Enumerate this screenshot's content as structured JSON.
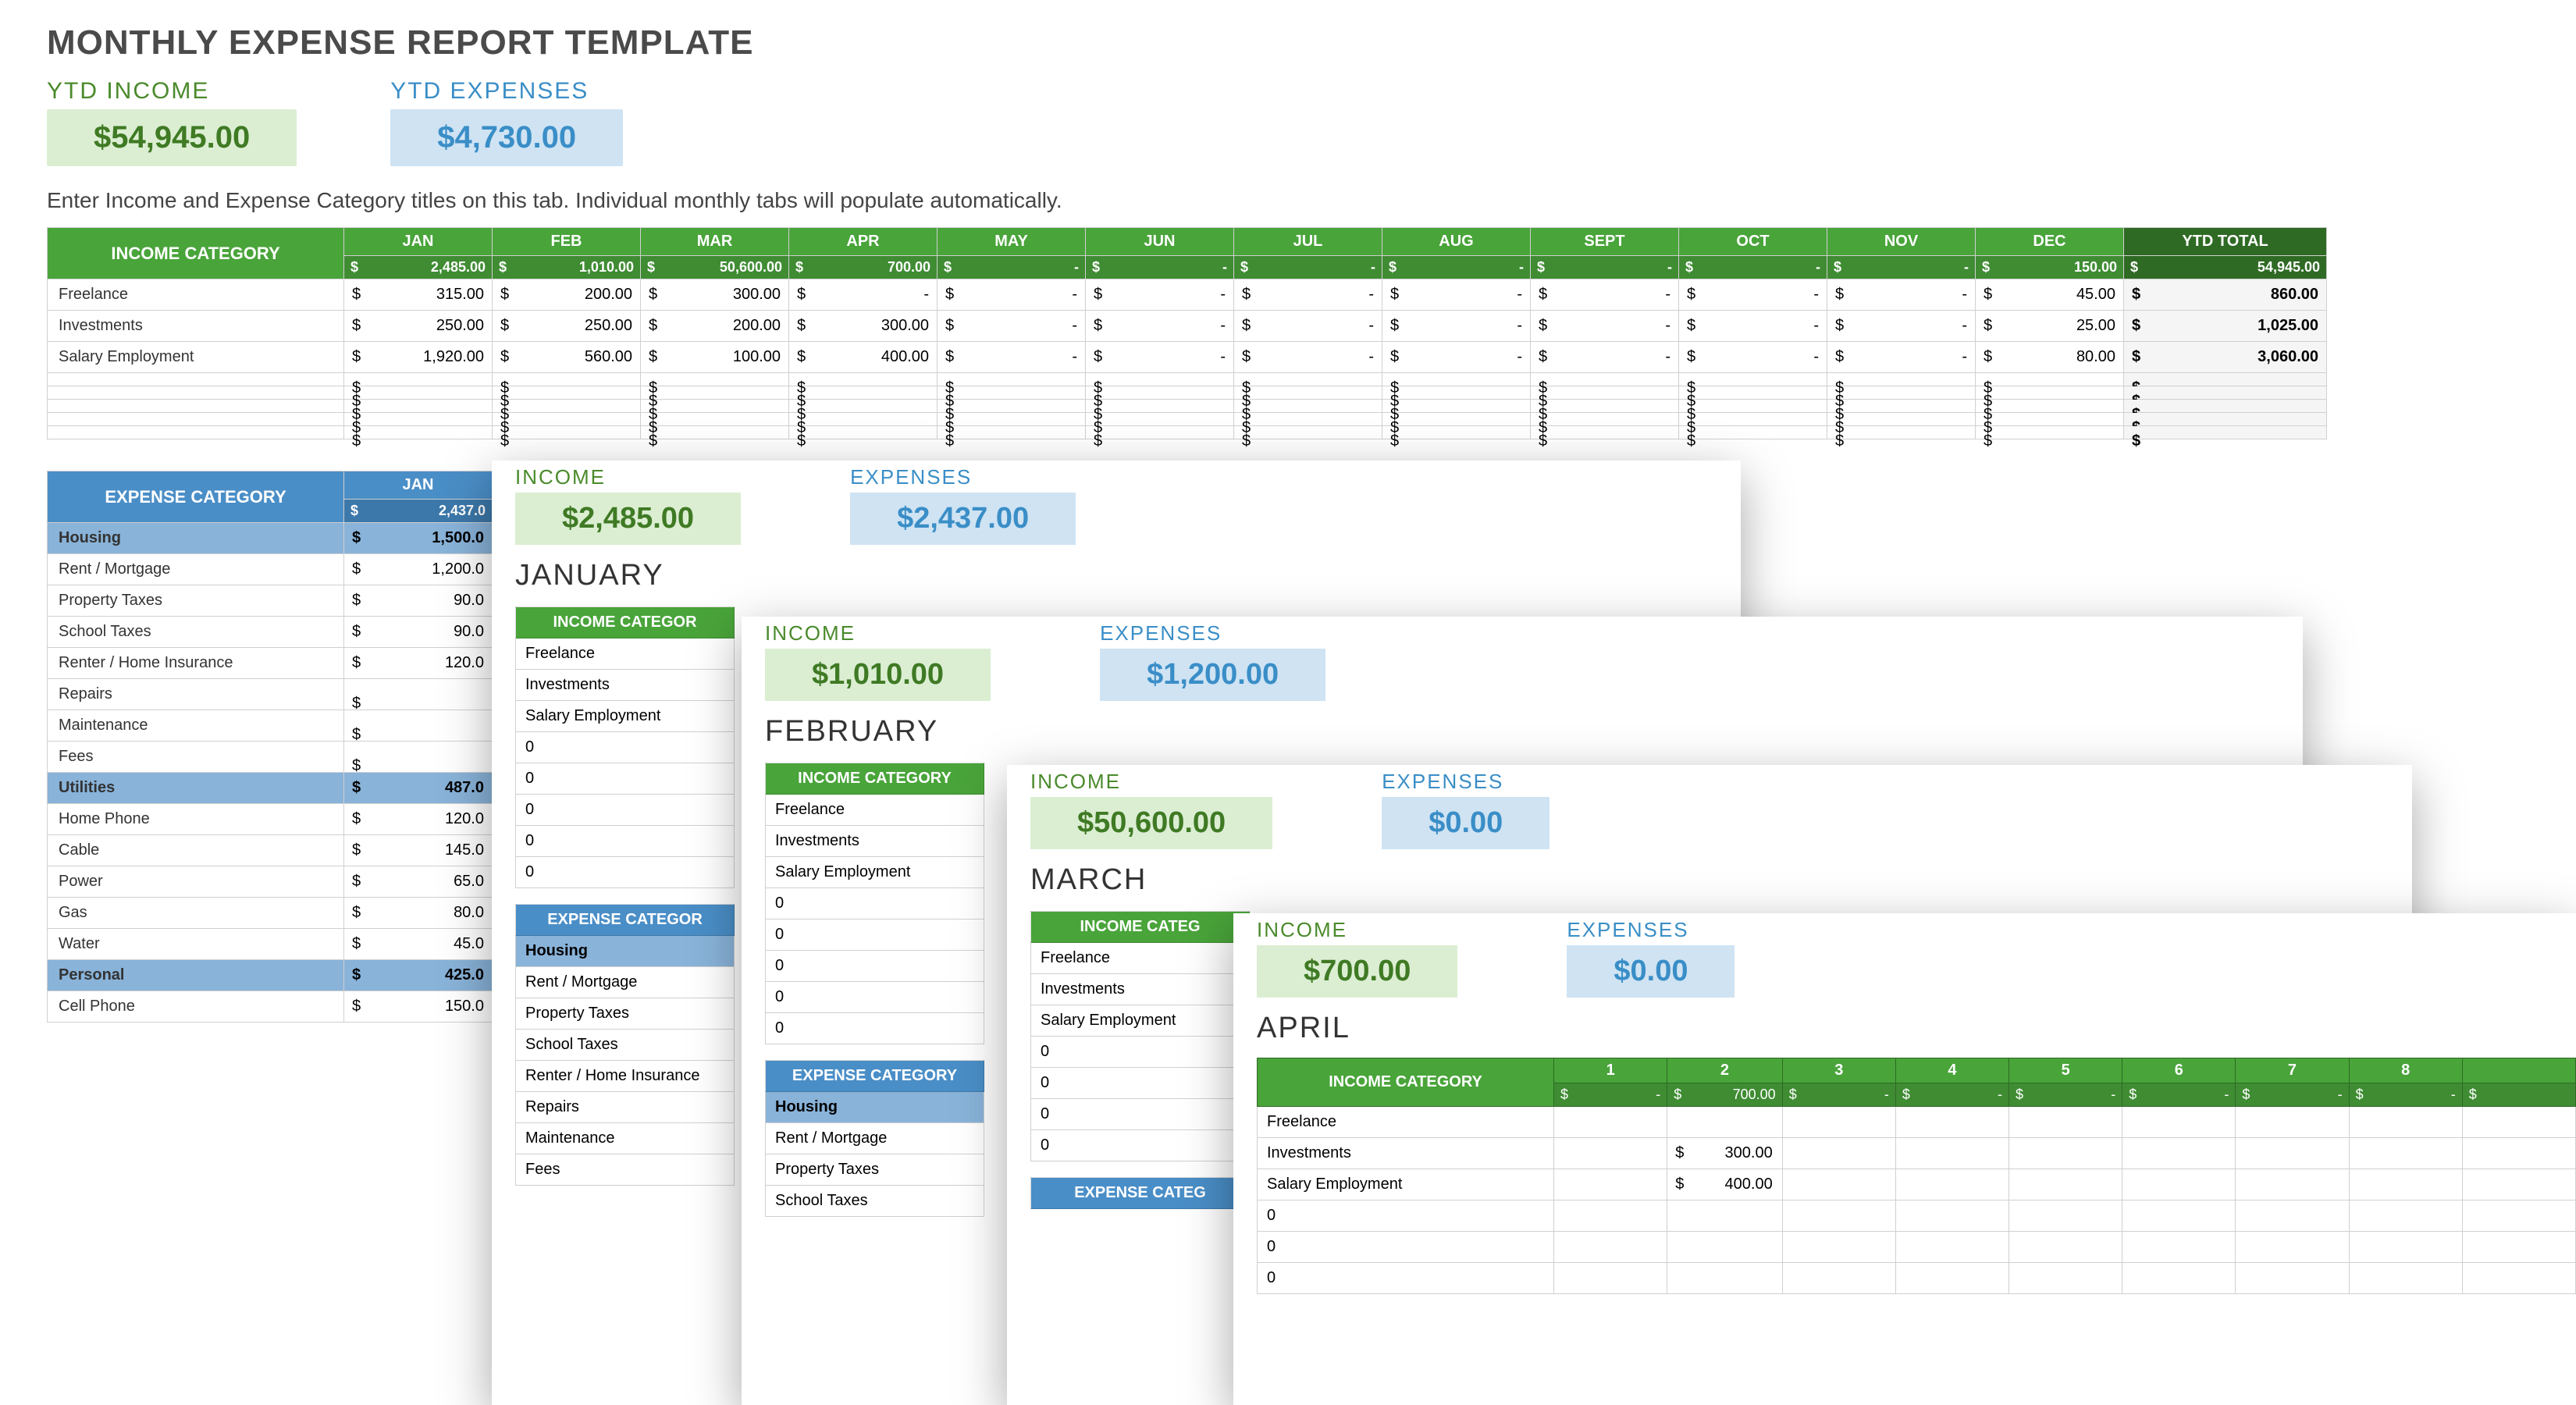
{
  "title": "MONTHLY EXPENSE REPORT TEMPLATE",
  "ytd_income_label": "YTD INCOME",
  "ytd_income_value": "$54,945.00",
  "ytd_expenses_label": "YTD EXPENSES",
  "ytd_expenses_value": "$4,730.00",
  "instruction": "Enter Income and Expense Category titles on this tab.  Individual monthly tabs will populate automatically.",
  "income_table": {
    "category_header": "INCOME CATEGORY",
    "months": [
      "JAN",
      "FEB",
      "MAR",
      "APR",
      "MAY",
      "JUN",
      "JUL",
      "AUG",
      "SEPT",
      "OCT",
      "NOV",
      "DEC"
    ],
    "ytd_header": "YTD TOTAL",
    "month_totals": [
      "2,485.00",
      "1,010.00",
      "50,600.00",
      "700.00",
      "-",
      "-",
      "-",
      "-",
      "-",
      "-",
      "-",
      "150.00"
    ],
    "ytd_total": "54,945.00",
    "rows": [
      {
        "label": "Freelance",
        "vals": [
          "315.00",
          "200.00",
          "300.00",
          "-",
          "-",
          "-",
          "-",
          "-",
          "-",
          "-",
          "-",
          "45.00"
        ],
        "ytd": "860.00"
      },
      {
        "label": "Investments",
        "vals": [
          "250.00",
          "250.00",
          "200.00",
          "300.00",
          "-",
          "-",
          "-",
          "-",
          "-",
          "-",
          "-",
          "25.00"
        ],
        "ytd": "1,025.00"
      },
      {
        "label": "Salary Employment",
        "vals": [
          "1,920.00",
          "560.00",
          "100.00",
          "400.00",
          "-",
          "-",
          "-",
          "-",
          "-",
          "-",
          "-",
          "80.00"
        ],
        "ytd": "3,060.00"
      }
    ],
    "blank_rows": 5
  },
  "expense_table": {
    "category_header": "EXPENSE CATEGORY",
    "jan_header": "JAN",
    "jan_total": "2,437.0",
    "rows": [
      {
        "label": "Housing",
        "group": true,
        "val": "1,500.0"
      },
      {
        "label": "Rent / Mortgage",
        "val": "1,200.0"
      },
      {
        "label": "Property Taxes",
        "val": "90.0"
      },
      {
        "label": "School Taxes",
        "val": "90.0"
      },
      {
        "label": "Renter / Home Insurance",
        "val": "120.0"
      },
      {
        "label": "Repairs",
        "val": ""
      },
      {
        "label": "Maintenance",
        "val": ""
      },
      {
        "label": "Fees",
        "val": ""
      },
      {
        "label": "Utilities",
        "group": true,
        "val": "487.0"
      },
      {
        "label": "Home Phone",
        "val": "120.0"
      },
      {
        "label": "Cable",
        "val": "145.0"
      },
      {
        "label": "Power",
        "val": "65.0"
      },
      {
        "label": "Gas",
        "val": "80.0"
      },
      {
        "label": "Water",
        "val": "45.0"
      },
      {
        "label": "Personal",
        "group": true,
        "val": "425.0"
      },
      {
        "label": "Cell Phone",
        "val": "150.0"
      }
    ]
  },
  "panels": {
    "jan": {
      "income_label": "INCOME",
      "income_value": "$2,485.00",
      "expenses_label": "EXPENSES",
      "expenses_value": "$2,437.00",
      "month": "JANUARY",
      "ic_header": "INCOME CATEGOR",
      "ic_rows": [
        "Freelance",
        "Investments",
        "Salary Employment",
        "0",
        "0",
        "0",
        "0",
        "0"
      ],
      "ex_header": "EXPENSE CATEGOR",
      "ex_rows": [
        {
          "l": "Housing",
          "g": true
        },
        {
          "l": "Rent / Mortgage"
        },
        {
          "l": "Property Taxes"
        },
        {
          "l": "School Taxes"
        },
        {
          "l": "Renter / Home Insurance"
        },
        {
          "l": "Repairs"
        },
        {
          "l": "Maintenance"
        },
        {
          "l": "Fees"
        }
      ]
    },
    "feb": {
      "income_label": "INCOME",
      "income_value": "$1,010.00",
      "expenses_label": "EXPENSES",
      "expenses_value": "$1,200.00",
      "month": "FEBRUARY",
      "ic_header": "INCOME CATEGORY",
      "ic_rows": [
        "Freelance",
        "Investments",
        "Salary Employment",
        "0",
        "0",
        "0",
        "0",
        "0"
      ],
      "ex_header": "EXPENSE CATEGORY",
      "ex_rows": [
        {
          "l": "Housing",
          "g": true
        },
        {
          "l": "Rent / Mortgage"
        },
        {
          "l": "Property Taxes"
        },
        {
          "l": "School Taxes"
        }
      ]
    },
    "mar": {
      "income_label": "INCOME",
      "income_value": "$50,600.00",
      "expenses_label": "EXPENSES",
      "expenses_value": "$0.00",
      "month": "MARCH",
      "ic_header": "INCOME CATEG",
      "ic_rows": [
        "Freelance",
        "Investments",
        "Salary Employment",
        "0",
        "0",
        "0",
        "0"
      ],
      "ex_header": "EXPENSE CATEG"
    },
    "apr": {
      "income_label": "INCOME",
      "income_value": "$700.00",
      "expenses_label": "EXPENSES",
      "expenses_value": "$0.00",
      "month": "APRIL",
      "ic_header": "INCOME CATEGORY",
      "days": [
        "1",
        "2",
        "3",
        "4",
        "5",
        "6",
        "7",
        "8"
      ],
      "day_vals": [
        "-",
        "700.00",
        "-",
        "-",
        "-",
        "-",
        "-",
        "-"
      ],
      "rows": [
        {
          "label": "Freelance",
          "vals": [
            "",
            "",
            "",
            "",
            "",
            "",
            "",
            ""
          ]
        },
        {
          "label": "Investments",
          "vals": [
            "",
            "300.00",
            "",
            "",
            "",
            "",
            "",
            ""
          ]
        },
        {
          "label": "Salary Employment",
          "vals": [
            "",
            "400.00",
            "",
            "",
            "",
            "",
            "",
            ""
          ]
        },
        {
          "label": "0",
          "vals": [
            "",
            "",
            "",
            "",
            "",
            "",
            "",
            ""
          ]
        },
        {
          "label": "0",
          "vals": [
            "",
            "",
            "",
            "",
            "",
            "",
            "",
            ""
          ]
        },
        {
          "label": "0",
          "vals": [
            "",
            "",
            "",
            "",
            "",
            "",
            "",
            ""
          ]
        }
      ]
    }
  }
}
